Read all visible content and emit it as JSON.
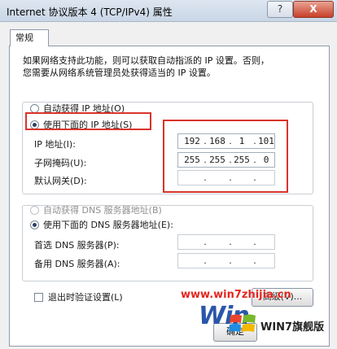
{
  "window": {
    "title": "Internet 协议版本 4 (TCP/IPv4) 属性",
    "help_glyph": "?",
    "close_glyph": "X"
  },
  "tabs": [
    {
      "label": "常规"
    }
  ],
  "description": {
    "line1": "如果网络支持此功能，则可以获取自动指派的 IP 设置。否则，",
    "line2": "您需要从网络系统管理员处获得适当的 IP 设置。"
  },
  "ip_section": {
    "auto_label": "自动获得 IP 地址(O)",
    "manual_label": "使用下面的 IP 地址(S)",
    "fields": [
      {
        "label": "IP 地址(I):",
        "octets": [
          "192",
          "168",
          "1",
          "101"
        ]
      },
      {
        "label": "子网掩码(U):",
        "octets": [
          "255",
          "255",
          "255",
          "0"
        ]
      },
      {
        "label": "默认网关(D):",
        "octets": [
          "",
          "",
          "",
          ""
        ]
      }
    ]
  },
  "dns_section": {
    "auto_label": "自动获得 DNS 服务器地址(B)",
    "manual_label": "使用下面的 DNS 服务器地址(E):",
    "fields": [
      {
        "label": "首选 DNS 服务器(P):",
        "octets": [
          "",
          "",
          "",
          ""
        ]
      },
      {
        "label": "备用 DNS 服务器(A):",
        "octets": [
          "",
          "",
          "",
          ""
        ]
      }
    ]
  },
  "validate_on_exit_label": "退出时验证设置(L)",
  "advanced_button": "高级(V)...",
  "ok_button": "确定",
  "watermark": {
    "url": "www.win7zhijia.cn",
    "big_text": "Win",
    "logo_text": "WIN7旗舰版"
  },
  "colors": {
    "highlight": "#d9342b",
    "selected_radio": "#2a3f66"
  }
}
